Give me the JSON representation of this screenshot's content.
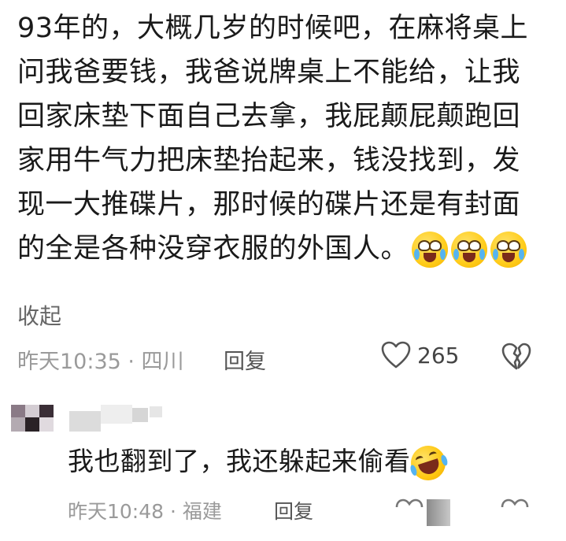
{
  "comment": {
    "lines": [
      "93年的，大概几岁的时候吧，在麻将桌上",
      "问我爸要钱，我爸说牌桌上不能给，让我",
      "回家床垫下面自己去拿，我屁颠屁颠跑回",
      "家用牛气力把床垫抬起来，钱没找到，发",
      "现一大推碟片，那时候的碟片还是有封面",
      "的全是各种没穿衣服的外国人。"
    ],
    "emojis": [
      "crying-laughing-emoji",
      "crying-laughing-emoji",
      "crying-laughing-emoji"
    ],
    "collapse_label": "收起",
    "time_location": "昨天10:35 · 四川",
    "reply_label": "回复",
    "like_count": "265"
  },
  "reply": {
    "text": "我也翻到了，我还躲起来偷看",
    "emoji": "rolling-laughing-emoji",
    "time_location": "昨天10:48 · 福建",
    "reply_label": "回复"
  },
  "colors": {
    "text": "#1a1a1a",
    "meta": "#9a9a9a",
    "emoji_yellow": "#ffcc1a",
    "tear_blue": "#56b4f0"
  }
}
